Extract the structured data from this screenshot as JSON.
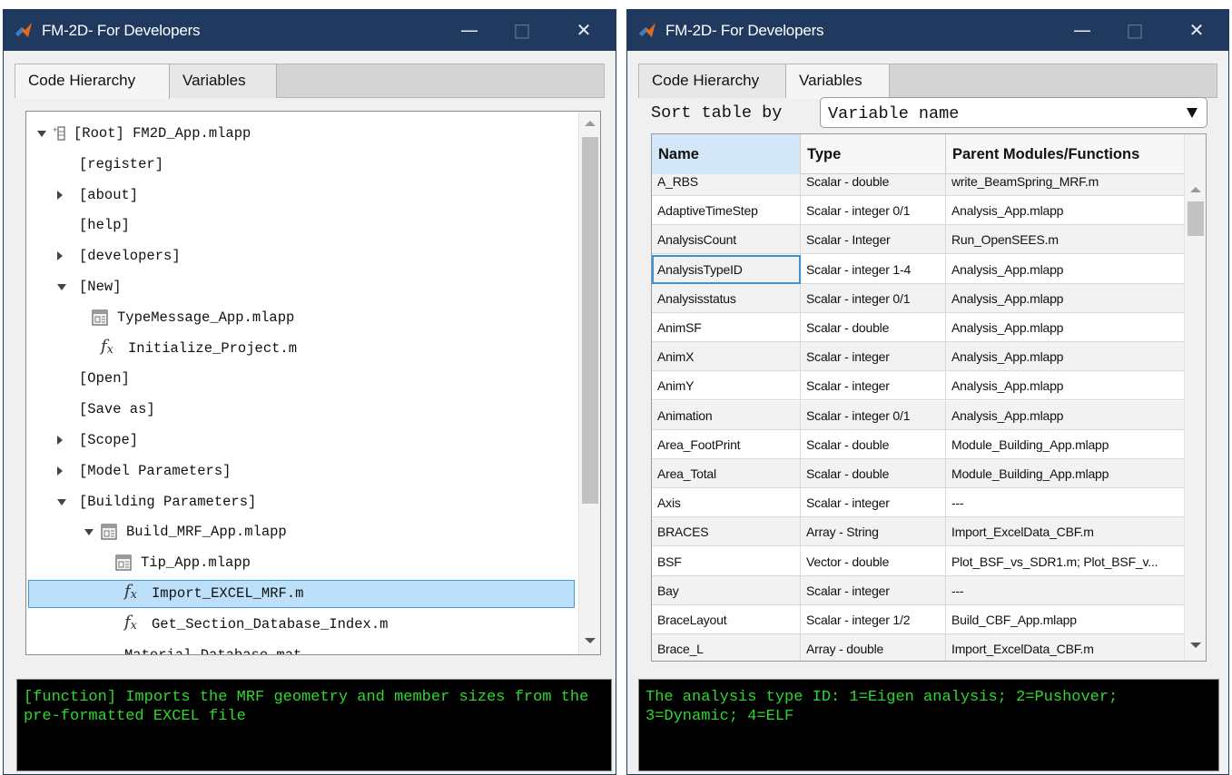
{
  "left_window": {
    "title": "FM-2D- For Developers",
    "controls": {
      "minimize": "—",
      "maximize": "□",
      "close": "✕"
    },
    "tabs": [
      {
        "label": "Code Hierarchy",
        "active": true
      },
      {
        "label": "Variables",
        "active": false
      }
    ],
    "tree": [
      {
        "label": "[Root] FM2D_App.mlapp",
        "level": 0,
        "caret": "down",
        "icon": "root-icon"
      },
      {
        "label": "[register]",
        "level": 1,
        "caret": "none",
        "icon": "none"
      },
      {
        "label": "[about]",
        "level": 1,
        "caret": "right",
        "icon": "none"
      },
      {
        "label": "[help]",
        "level": 1,
        "caret": "none",
        "icon": "none"
      },
      {
        "label": "[developers]",
        "level": 1,
        "caret": "right",
        "icon": "none"
      },
      {
        "label": "[New]",
        "level": 1,
        "caret": "down",
        "icon": "none"
      },
      {
        "label": "TypeMessage_App.mlapp",
        "level": 2,
        "caret": "none",
        "icon": "app-icon"
      },
      {
        "label": "Initialize_Project.m",
        "level": 2,
        "caret": "none",
        "icon": "fx-icon"
      },
      {
        "label": "[Open]",
        "level": 1,
        "caret": "none",
        "icon": "none"
      },
      {
        "label": "[Save as]",
        "level": 1,
        "caret": "none",
        "icon": "none"
      },
      {
        "label": "[Scope]",
        "level": 1,
        "caret": "right",
        "icon": "none"
      },
      {
        "label": "[Model Parameters]",
        "level": 1,
        "caret": "right",
        "icon": "none"
      },
      {
        "label": "[Building Parameters]",
        "level": 1,
        "caret": "down",
        "icon": "none"
      },
      {
        "label": "Build_MRF_App.mlapp",
        "level": 2,
        "caret": "down",
        "icon": "app-icon"
      },
      {
        "label": "Tip_App.mlapp",
        "level": 3,
        "caret": "none",
        "icon": "app-icon"
      },
      {
        "label": "Import_EXCEL_MRF.m",
        "level": 3,
        "caret": "none",
        "icon": "fx-icon",
        "selected": true
      },
      {
        "label": "Get_Section_Database_Index.m",
        "level": 3,
        "caret": "none",
        "icon": "fx-icon"
      },
      {
        "label": "Material_Database.mat",
        "level": 3,
        "caret": "none",
        "icon": "none"
      }
    ],
    "console_text": "[function] Imports the MRF geometry and member sizes from the pre-formatted EXCEL file"
  },
  "right_window": {
    "title": "FM-2D- For Developers",
    "controls": {
      "minimize": "—",
      "maximize": "□",
      "close": "✕"
    },
    "tabs": [
      {
        "label": "Code Hierarchy",
        "active": false
      },
      {
        "label": "Variables",
        "active": true
      }
    ],
    "sort_label": "Sort table by",
    "sort_value": "Variable name",
    "table": {
      "columns": [
        "Name",
        "Type",
        "Parent Modules/Functions"
      ],
      "rows": [
        [
          "A_RBS",
          "Scalar - double",
          "write_BeamSpring_MRF.m"
        ],
        [
          "AdaptiveTimeStep",
          "Scalar - integer 0/1",
          "Analysis_App.mlapp"
        ],
        [
          "AnalysisCount",
          "Scalar - Integer",
          "Run_OpenSEES.m"
        ],
        [
          "AnalysisTypeID",
          "Scalar - integer 1-4",
          "Analysis_App.mlapp"
        ],
        [
          "Analysisstatus",
          "Scalar - integer 0/1",
          "Analysis_App.mlapp"
        ],
        [
          "AnimSF",
          "Scalar - double",
          "Analysis_App.mlapp"
        ],
        [
          "AnimX",
          "Scalar - integer",
          "Analysis_App.mlapp"
        ],
        [
          "AnimY",
          "Scalar - integer",
          "Analysis_App.mlapp"
        ],
        [
          "Animation",
          "Scalar - integer 0/1",
          "Analysis_App.mlapp"
        ],
        [
          "Area_FootPrint",
          "Scalar - double",
          "Module_Building_App.mlapp"
        ],
        [
          "Area_Total",
          "Scalar - double",
          "Module_Building_App.mlapp"
        ],
        [
          "Axis",
          "Scalar - integer",
          "---"
        ],
        [
          "BRACES",
          "Array - String",
          "Import_ExcelData_CBF.m"
        ],
        [
          "BSF",
          "Vector - double",
          "Plot_BSF_vs_SDR1.m; Plot_BSF_v..."
        ],
        [
          "Bay",
          "Scalar - integer",
          "---"
        ],
        [
          "BraceLayout",
          "Scalar - integer 1/2",
          "Build_CBF_App.mlapp"
        ],
        [
          "Brace_L",
          "Array - double",
          "Import_ExcelData_CBF.m"
        ]
      ],
      "focused_row": 3
    },
    "console_text": "The analysis type ID: 1=Eigen analysis; 2=Pushover; 3=Dynamic; 4=ELF"
  }
}
